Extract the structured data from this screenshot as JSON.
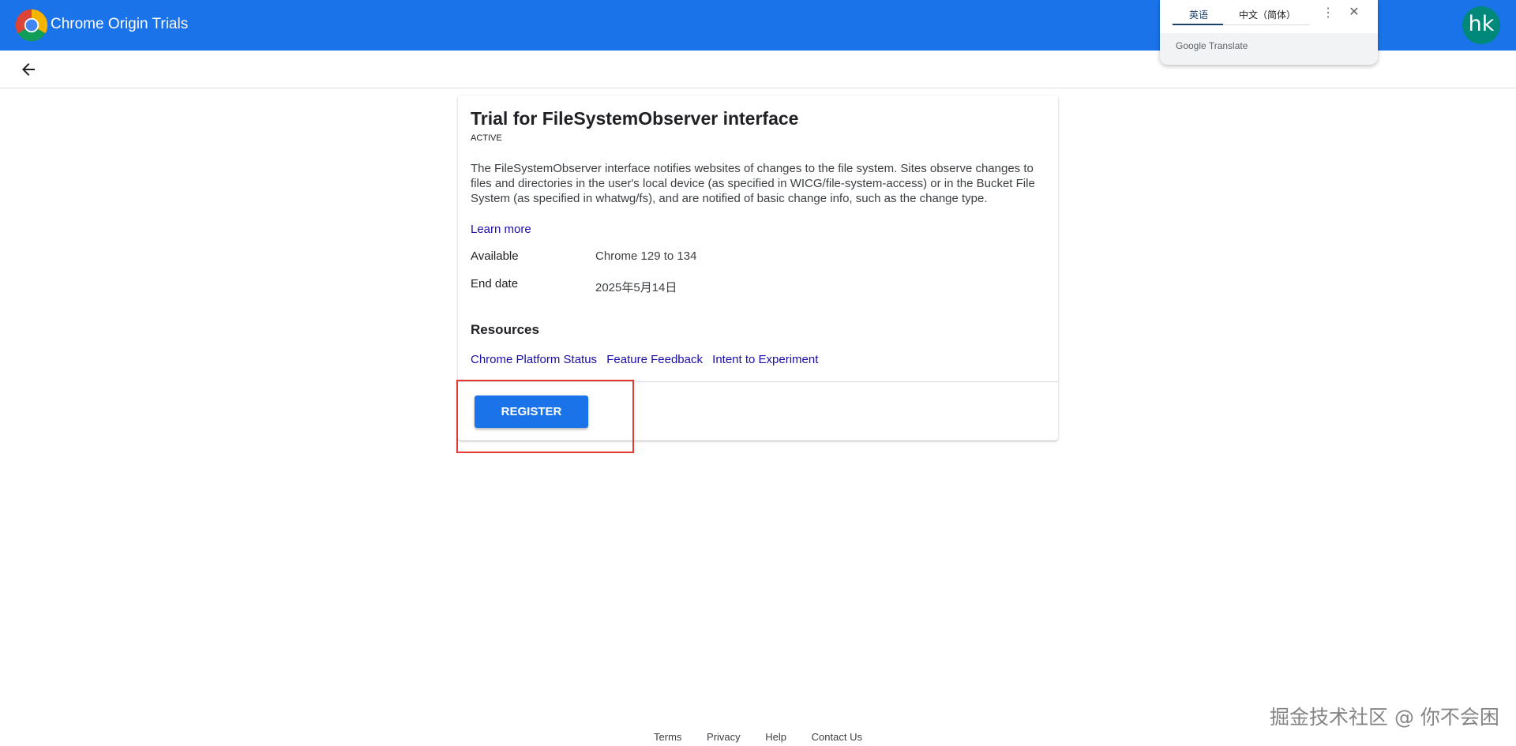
{
  "app": {
    "title": "Chrome Origin Trials",
    "avatar_initials": "hk",
    "brand_color": "#1a73e8",
    "avatar_color": "#00897b"
  },
  "translate": {
    "source_tab": "英语",
    "target_tab": "中文（简体）",
    "brand": "Google Translate"
  },
  "trial": {
    "title": "Trial for FileSystemObserver interface",
    "status": "ACTIVE",
    "description": "The FileSystemObserver interface notifies websites of changes to the file system. Sites observe changes to files and directories in the user's local device (as specified in WICG/file-system-access) or in the Bucket File System (as specified in whatwg/fs), and are notified of basic change info, such as the change type.",
    "learn_more": "Learn more",
    "available_label": "Available",
    "available_value": "Chrome 129 to 134",
    "end_date_label": "End date",
    "end_date_value": "2025年5月14日",
    "resources_heading": "Resources",
    "resources": [
      "Chrome Platform Status",
      "Feature Feedback",
      "Intent to Experiment"
    ],
    "register_label": "REGISTER"
  },
  "footer": {
    "links": [
      "Terms",
      "Privacy",
      "Help",
      "Contact Us"
    ]
  },
  "watermark": "掘金技术社区 @ 你不会困",
  "icons": {
    "back": "arrow-left-icon",
    "more": "more-vert-icon",
    "close": "close-icon",
    "logo": "chrome-logo-icon"
  }
}
